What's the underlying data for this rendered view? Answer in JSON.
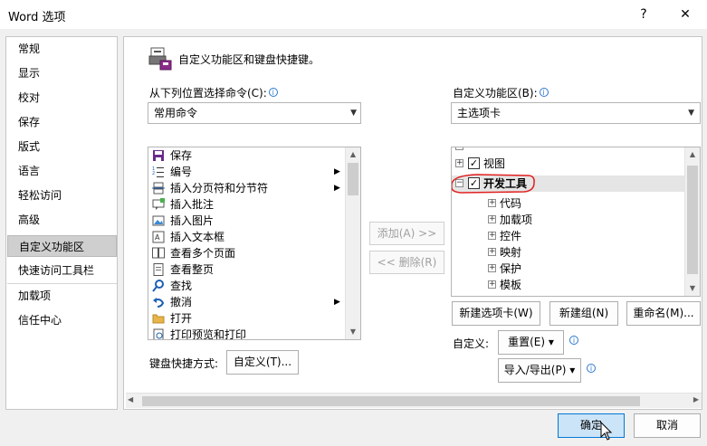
{
  "window": {
    "title": "Word 选项",
    "help_glyph": "?",
    "close_glyph": "✕"
  },
  "sidebar": {
    "items": [
      {
        "label": "常规"
      },
      {
        "label": "显示"
      },
      {
        "label": "校对"
      },
      {
        "label": "保存"
      },
      {
        "label": "版式"
      },
      {
        "label": "语言"
      },
      {
        "label": "轻松访问"
      },
      {
        "label": "高级"
      },
      {
        "label": "自定义功能区",
        "selected": true
      },
      {
        "label": "快速访问工具栏"
      },
      {
        "label": "加载项"
      },
      {
        "label": "信任中心"
      }
    ]
  },
  "header": {
    "title": "自定义功能区和键盘快捷键。"
  },
  "left_panel": {
    "label": "从下列位置选择命令(C):",
    "dropdown_value": "常用命令",
    "commands": [
      {
        "label": "保存",
        "icon": "save-icon"
      },
      {
        "label": "编号",
        "icon": "numbering-icon",
        "submenu": true
      },
      {
        "label": "插入分页符和分节符",
        "icon": "page-break-icon",
        "submenu": true
      },
      {
        "label": "插入批注",
        "icon": "comment-icon"
      },
      {
        "label": "插入图片",
        "icon": "picture-icon"
      },
      {
        "label": "插入文本框",
        "icon": "textbox-icon"
      },
      {
        "label": "查看多个页面",
        "icon": "multi-page-icon"
      },
      {
        "label": "查看整页",
        "icon": "full-page-icon"
      },
      {
        "label": "查找",
        "icon": "find-icon"
      },
      {
        "label": "撤消",
        "icon": "undo-icon",
        "submenu": true
      },
      {
        "label": "打开",
        "icon": "open-folder-icon"
      },
      {
        "label": "打印预览和打印",
        "icon": "print-preview-icon"
      }
    ]
  },
  "middle_buttons": {
    "add": "添加(A) >>",
    "remove": "<< 删除(R)"
  },
  "right_panel": {
    "label": "自定义功能区(B):",
    "dropdown_value": "主选项卡",
    "tree": [
      {
        "label": "视图",
        "level": 0,
        "expander": "+",
        "checked": true
      },
      {
        "label": "开发工具",
        "level": 0,
        "expander": "−",
        "checked": true,
        "highlighted": true
      },
      {
        "label": "代码",
        "level": 1,
        "expander": "+"
      },
      {
        "label": "加载项",
        "level": 1,
        "expander": "+"
      },
      {
        "label": "控件",
        "level": 1,
        "expander": "+"
      },
      {
        "label": "映射",
        "level": 1,
        "expander": "+"
      },
      {
        "label": "保护",
        "level": 1,
        "expander": "+"
      },
      {
        "label": "模板",
        "level": 1,
        "expander": "+"
      }
    ],
    "new_tab": "新建选项卡(W)",
    "new_group": "新建组(N)",
    "rename": "重命名(M)...",
    "customize_label": "自定义:",
    "reset": "重置(E) ▾",
    "import_export": "导入/导出(P) ▾"
  },
  "keyboard": {
    "label": "键盘快捷方式:",
    "button": "自定义(T)..."
  },
  "footer": {
    "ok": "确定",
    "cancel": "取消"
  },
  "colors": {
    "highlight_oval": "#e02020",
    "ok_button_bg": "#cce4f7",
    "ok_button_border": "#0078d7",
    "info_blue": "#2b79d0"
  }
}
